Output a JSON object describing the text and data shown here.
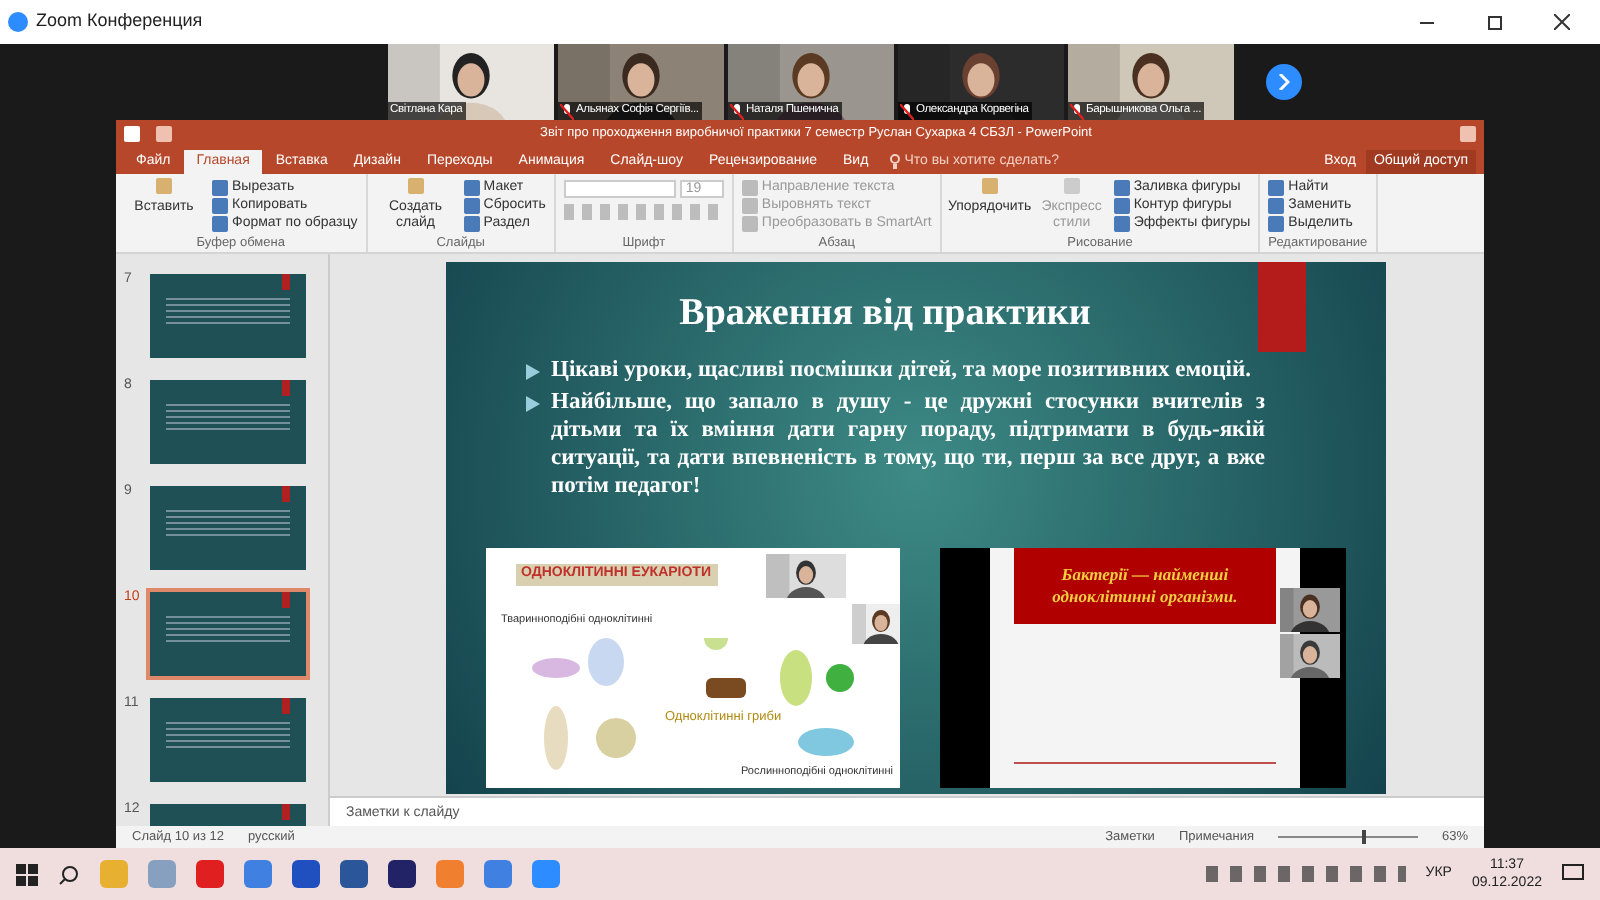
{
  "zoom": {
    "title": "Zoom Конференция"
  },
  "participants": [
    {
      "name": "Світлана Кара",
      "muted": false
    },
    {
      "name": "Альянах Софія Сергіїв...",
      "muted": true
    },
    {
      "name": "Наталя Пшенична",
      "muted": true
    },
    {
      "name": "Олександра Корвегіна",
      "muted": true
    },
    {
      "name": "Барышникова Ольга ...",
      "muted": true
    }
  ],
  "powerpoint": {
    "title": "Звіт про проходження виробничої практики 7 семестр Руслан Сухарка 4 СБЗЛ - PowerPoint",
    "tabs": [
      {
        "label": "Файл",
        "selected": false
      },
      {
        "label": "Главная",
        "selected": true
      },
      {
        "label": "Вставка",
        "selected": false
      },
      {
        "label": "Дизайн",
        "selected": false
      },
      {
        "label": "Переходы",
        "selected": false
      },
      {
        "label": "Анимация",
        "selected": false
      },
      {
        "label": "Слайд-шоу",
        "selected": false
      },
      {
        "label": "Рецензирование",
        "selected": false
      },
      {
        "label": "Вид",
        "selected": false
      }
    ],
    "tell_me": "Что вы хотите сделать?",
    "sign_in": "Вход",
    "share": "Общий доступ",
    "ribbon": [
      {
        "label": "Буфер обмена",
        "big": "Вставить",
        "items": [
          "Вырезать",
          "Копировать",
          "Формат по образцу"
        ]
      },
      {
        "label": "Слайды",
        "big": "Создать слайд",
        "items": [
          "Макет",
          "Сбросить",
          "Раздел"
        ]
      },
      {
        "label": "Шрифт",
        "font_size": "19"
      },
      {
        "label": "Абзац",
        "items": [
          "Направление текста",
          "Выровнять текст",
          "Преобразовать в SmartArt"
        ]
      },
      {
        "label": "Рисование",
        "big": "Упорядочить",
        "big2": "Экспресс стили",
        "items": [
          "Заливка фигуры",
          "Контур фигуры",
          "Эффекты фигуры"
        ]
      },
      {
        "label": "Редактирование",
        "items": [
          "Найти",
          "Заменить",
          "Выделить"
        ]
      }
    ],
    "thumbnails": [
      {
        "number": "7",
        "selected": false
      },
      {
        "number": "8",
        "selected": false
      },
      {
        "number": "9",
        "selected": false
      },
      {
        "number": "10",
        "selected": true
      },
      {
        "number": "11",
        "selected": false
      },
      {
        "number": "12",
        "selected": false
      }
    ],
    "slide": {
      "title": "Враження від практики",
      "bullets": [
        "Цікаві уроки, щасливі посмішки дітей, та море позитивних емоцій.",
        "Найбільше, що запало в душу - це дружні стосунки вчителів з дітьми та їх вміння дати гарну пораду, підтримати в будь-якій ситуації, та дати впевненість в тому, що ти, перш за все друг, а вже потім педагог!"
      ],
      "left_image": {
        "heading": "ОДНОКЛІТИННІ ЕУКАРІОТИ",
        "captions": [
          "Тваринноподібні одноклітинні",
          "Одноклітинні гриби",
          "Рослинноподібні одноклітинні"
        ]
      },
      "right_image": {
        "caption": "Бактерії — найменші одноклітинні організми."
      }
    },
    "notes": "Заметки к слайду",
    "status": {
      "slide": "Слайд 10 из 12",
      "language": "русский",
      "notes": "Заметки",
      "comments": "Примечания",
      "zoom": "63%",
      "level": 0.6
    }
  },
  "taskbar": {
    "language": "УКР",
    "time": "11:37",
    "date": "09.12.2022"
  }
}
